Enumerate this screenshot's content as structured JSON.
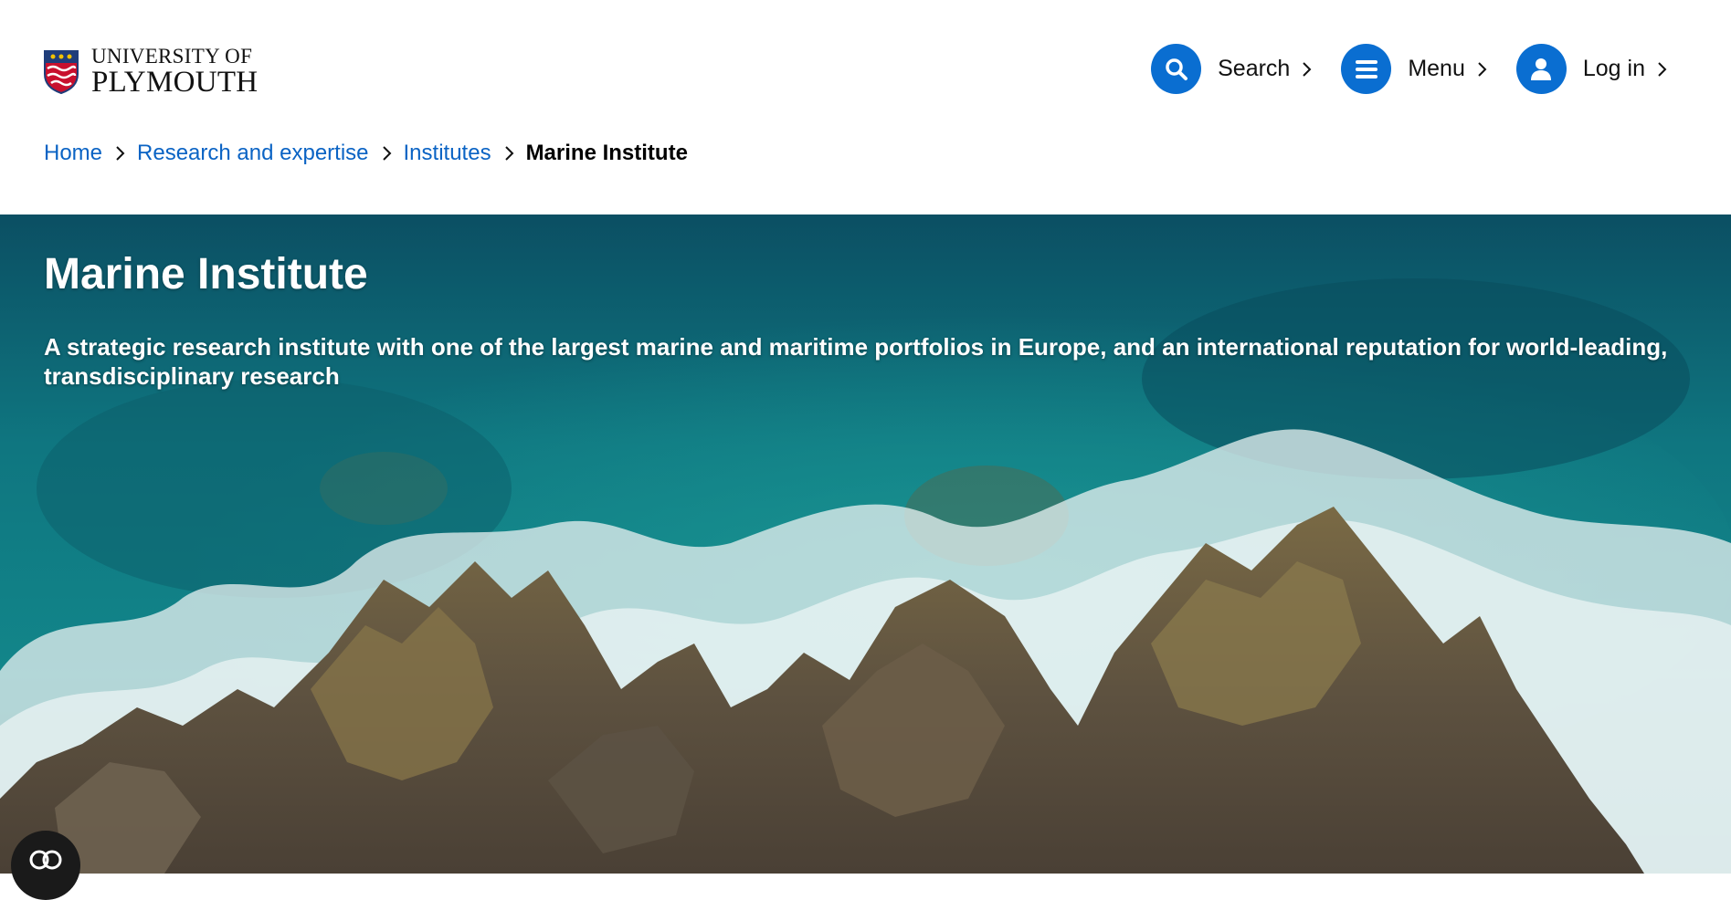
{
  "brand": {
    "line1": "UNIVERSITY OF",
    "line2": "PLYMOUTH",
    "crest_icon": "university-crest-icon"
  },
  "nav": {
    "search": {
      "label": "Search",
      "icon": "search-icon"
    },
    "menu": {
      "label": "Menu",
      "icon": "hamburger-menu-icon"
    },
    "login": {
      "label": "Log in",
      "icon": "user-icon"
    },
    "accent_color": "#0a6ed1"
  },
  "breadcrumb": {
    "items": [
      "Home",
      "Research and expertise",
      "Institutes"
    ],
    "current": "Marine Institute",
    "link_color": "#0a63c4"
  },
  "hero": {
    "title": "Marine Institute",
    "subtitle": "A strategic research institute with one of the largest marine and maritime portfolios in Europe, and an international reputation for world-leading, transdisciplinary research",
    "image": "aerial-ocean-rocky-coast"
  },
  "floating": {
    "icon": "cookie-settings-icon"
  }
}
